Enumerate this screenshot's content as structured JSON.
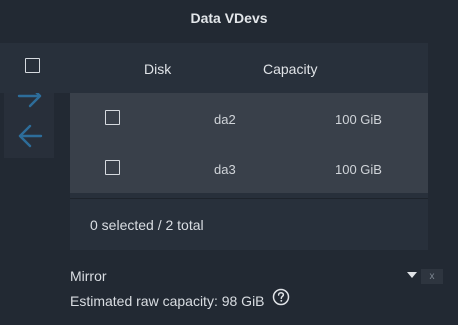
{
  "title": "Data VDevs",
  "move_buttons": {
    "right_icon": "arrow-right-icon",
    "left_icon": "arrow-left-icon"
  },
  "table": {
    "columns": [
      "Disk",
      "Capacity"
    ],
    "rows": [
      {
        "disk": "da2",
        "capacity": "100 GiB"
      },
      {
        "disk": "da3",
        "capacity": "100 GiB"
      }
    ],
    "footer": "0 selected / 2 total"
  },
  "layout": {
    "selected": "Mirror",
    "clear_label": "x"
  },
  "estimated_capacity": "Estimated raw capacity: 98 GiB",
  "help_icon": "help-circle-icon",
  "colors": {
    "background": "#222933",
    "panel": "#28303b",
    "row": "#39404a",
    "arrow": "#2d6d9a"
  }
}
